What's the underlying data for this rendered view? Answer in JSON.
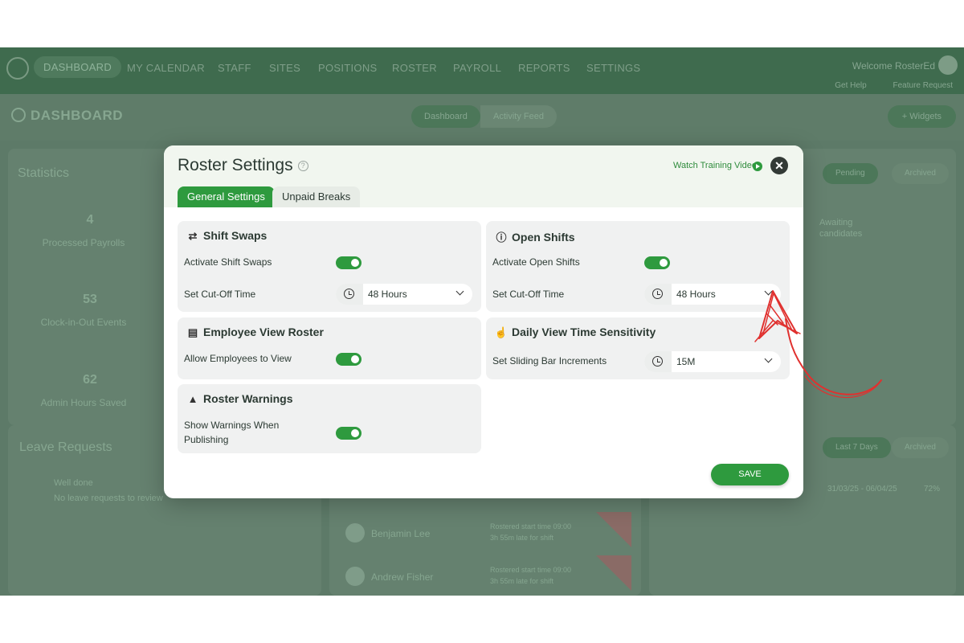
{
  "nav": {
    "items": [
      "DASHBOARD",
      "MY CALENDAR",
      "STAFF",
      "SITES",
      "POSITIONS",
      "ROSTER",
      "PAYROLL",
      "REPORTS",
      "SETTINGS"
    ],
    "welcome": "Welcome RosterEd",
    "get_help": "Get Help",
    "feature_request": "Feature Request"
  },
  "dashboard": {
    "title": "DASHBOARD",
    "seg_dashboard": "Dashboard",
    "seg_feed": "Activity Feed",
    "widgets": "+ Widgets",
    "statistics": "Statistics",
    "stats": [
      {
        "value": "4",
        "label": "Processed Payrolls"
      },
      {
        "value": "53",
        "label": "Clock-in-Out Events"
      },
      {
        "value": "62",
        "label": "Admin Hours Saved"
      }
    ],
    "pending": "Pending",
    "archived": "Archived",
    "awaiting": "Awaiting",
    "candidates": "candidates",
    "leave_requests": "Leave Requests",
    "well_done": "Well done",
    "no_leave": "No leave requests to review",
    "last7": "Last 7 Days",
    "archived2": "Archived",
    "date_range": "31/03/25 - 06/04/25",
    "percent": "72%",
    "people": [
      {
        "name": "Benjamin Lee",
        "line1": "Rostered start time 09:00",
        "line2": "3h 55m late for shift"
      },
      {
        "name": "Andrew Fisher",
        "line1": "Rostered start time 09:00",
        "line2": "3h 55m late for shift"
      }
    ]
  },
  "modal": {
    "title": "Roster Settings",
    "help_icon": "question-circle-icon",
    "video_link": "Watch Training Video",
    "tabs": {
      "general": "General Settings",
      "unpaid": "Unpaid Breaks"
    },
    "shift_swaps": {
      "title": "Shift Swaps",
      "activate_label": "Activate Shift Swaps",
      "activate_on": true,
      "cutoff_label": "Set Cut-Off Time",
      "cutoff_value": "48 Hours"
    },
    "open_shifts": {
      "title": "Open Shifts",
      "activate_label": "Activate Open Shifts",
      "activate_on": true,
      "cutoff_label": "Set Cut-Off Time",
      "cutoff_value": "48 Hours"
    },
    "employee_view": {
      "title": "Employee View Roster",
      "allow_label": "Allow Employees to View",
      "allow_on": true
    },
    "daily_view": {
      "title": "Daily View Time Sensitivity",
      "increments_label": "Set Sliding Bar Increments",
      "increments_value": "15M"
    },
    "warnings": {
      "title": "Roster Warnings",
      "show_label_1": "Show Warnings When",
      "show_label_2": "Publishing",
      "show_on": true
    },
    "save": "SAVE"
  },
  "colors": {
    "accent": "#2e9a3e",
    "annotation": "#e0312f"
  }
}
